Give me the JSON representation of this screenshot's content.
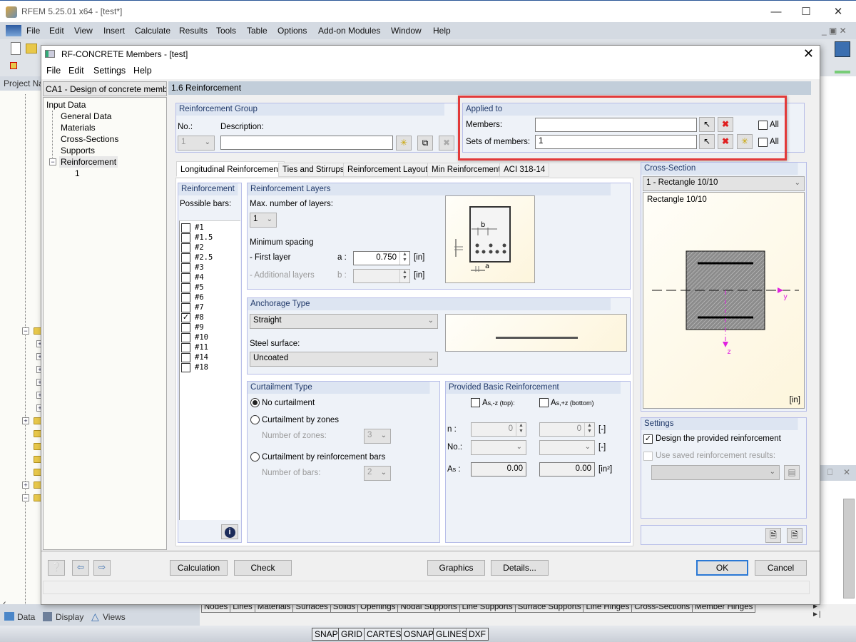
{
  "app": {
    "title": "RFEM 5.25.01 x64 - [test*]",
    "menu": [
      "File",
      "Edit",
      "View",
      "Insert",
      "Calculate",
      "Results",
      "Tools",
      "Table",
      "Options",
      "Add-on Modules",
      "Window",
      "Help"
    ],
    "project_panel_label": "Project Na",
    "nav_tabs": [
      "Data",
      "Display",
      "Views"
    ],
    "table_tabs": [
      "Nodes",
      "Lines",
      "Materials",
      "Surfaces",
      "Solids",
      "Openings",
      "Nodal Supports",
      "Line Supports",
      "Surface Supports",
      "Line Hinges",
      "Cross-Sections",
      "Member Hinges"
    ],
    "status_buttons": [
      "SNAP",
      "GRID",
      "CARTES",
      "OSNAP",
      "GLINES",
      "DXF"
    ]
  },
  "dialog": {
    "title": "RF-CONCRETE Members - [test]",
    "menu": [
      "File",
      "Edit",
      "Settings",
      "Help"
    ],
    "case_combo": "CA1 - Design of concrete memb",
    "tree": {
      "root": "Input Data",
      "items": [
        "General Data",
        "Materials",
        "Cross-Sections",
        "Supports",
        "Reinforcement"
      ],
      "sub_item": "1"
    },
    "page_header": "1.6 Reinforcement",
    "reinforcement_group": {
      "title": "Reinforcement Group",
      "no_label": "No.:",
      "no_value": "1",
      "description_label": "Description:",
      "description_value": ""
    },
    "applied_to": {
      "title": "Applied to",
      "members_label": "Members:",
      "members_value": "",
      "sets_label": "Sets of members:",
      "sets_value": "1",
      "all_label": "All",
      "members_all": false,
      "sets_all": false
    },
    "tabs": [
      "Longitudinal Reinforcement",
      "Ties and Stirrups",
      "Reinforcement Layout",
      "Min Reinforcement",
      "ACI 318-14"
    ],
    "active_tab": 0,
    "reinforcement": {
      "title": "Reinforcement",
      "possible_bars_label": "Possible bars:",
      "bars": [
        {
          "label": "#1",
          "checked": false
        },
        {
          "label": "#1.5",
          "checked": false
        },
        {
          "label": "#2",
          "checked": false
        },
        {
          "label": "#2.5",
          "checked": false
        },
        {
          "label": "#3",
          "checked": false
        },
        {
          "label": "#4",
          "checked": false
        },
        {
          "label": "#5",
          "checked": false
        },
        {
          "label": "#6",
          "checked": false
        },
        {
          "label": "#7",
          "checked": false
        },
        {
          "label": "#8",
          "checked": true
        },
        {
          "label": "#9",
          "checked": false
        },
        {
          "label": "#10",
          "checked": false
        },
        {
          "label": "#11",
          "checked": false
        },
        {
          "label": "#14",
          "checked": false
        },
        {
          "label": "#18",
          "checked": false
        }
      ]
    },
    "layers": {
      "title": "Reinforcement Layers",
      "max_layers_label": "Max. number of layers:",
      "max_layers_value": "1",
      "min_spacing_label": "Minimum spacing",
      "first_layer_label": "- First layer",
      "first_layer_symbol": "a :",
      "first_layer_value": "0.750",
      "additional_layers_label": "- Additional layers",
      "additional_layers_symbol": "b :",
      "additional_layers_value": "",
      "unit": "[in]",
      "diagram_labels": {
        "a": "a",
        "b": "b"
      }
    },
    "anchorage": {
      "title": "Anchorage Type",
      "type_value": "Straight",
      "steel_surface_label": "Steel surface:",
      "steel_surface_value": "Uncoated"
    },
    "curtailment": {
      "title": "Curtailment Type",
      "options": [
        "No curtailment",
        "Curtailment by zones",
        "Curtailment by reinforcement bars"
      ],
      "selected": 0,
      "zones_label": "Number of zones:",
      "zones_value": "3",
      "bars_label": "Number of bars:",
      "bars_value": "2"
    },
    "provided": {
      "title": "Provided Basic Reinforcement",
      "top_label": "A",
      "top_sub": "s,-z (top):",
      "bottom_label": "A",
      "bottom_sub": "s,+z (bottom)",
      "n_label": "n :",
      "n_top": "0",
      "n_bottom": "0",
      "n_unit": "[-]",
      "no_label": "No.:",
      "no_unit": "[-]",
      "as_label": "A",
      "as_sub": "s",
      "as_colon": " :",
      "as_top": "0.00",
      "as_bottom": "0.00",
      "as_unit": "[in²]"
    },
    "cross_section": {
      "title": "Cross-Section",
      "combo_value": "1 - Rectangle 10/10",
      "name": "Rectangle 10/10",
      "axis_y": "y",
      "axis_z": "z",
      "unit": "[in]"
    },
    "settings": {
      "title": "Settings",
      "design_label": "Design the provided reinforcement",
      "design_checked": true,
      "use_saved_label": "Use saved reinforcement results:",
      "use_saved_checked": false
    },
    "buttons": {
      "calculation": "Calculation",
      "check": "Check",
      "graphics": "Graphics",
      "details": "Details...",
      "ok": "OK",
      "cancel": "Cancel"
    }
  }
}
